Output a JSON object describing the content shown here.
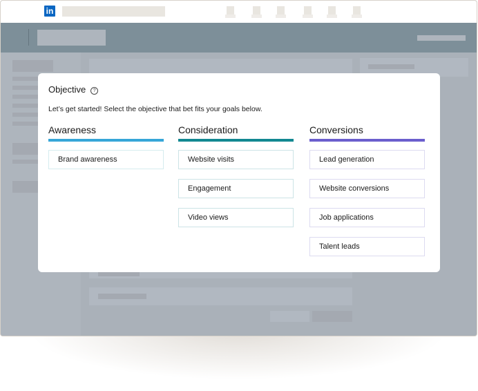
{
  "topbar": {
    "logo_text": "in",
    "nav_icons": [
      "nav-placeholder-icon",
      "nav-placeholder-icon",
      "nav-placeholder-icon",
      "nav-placeholder-icon",
      "nav-placeholder-icon",
      "nav-placeholder-icon"
    ]
  },
  "modal": {
    "title": "Objective",
    "help_icon": "?",
    "subtitle": "Let’s get started! Select the objective that bet fits your goals below.",
    "columns": [
      {
        "label": "Awareness",
        "color": "#36a6d8",
        "border_color": "#d5ecef",
        "options": [
          "Brand awareness"
        ]
      },
      {
        "label": "Consideration",
        "color": "#128891",
        "border_color": "#cce3e6",
        "options": [
          "Website visits",
          "Engagement",
          "Video views"
        ]
      },
      {
        "label": "Conversions",
        "color": "#6b5ecd",
        "border_color": "#dcdaf0",
        "options": [
          "Lead generation",
          "Website conversions",
          "Job applications",
          "Talent leads"
        ]
      }
    ]
  }
}
